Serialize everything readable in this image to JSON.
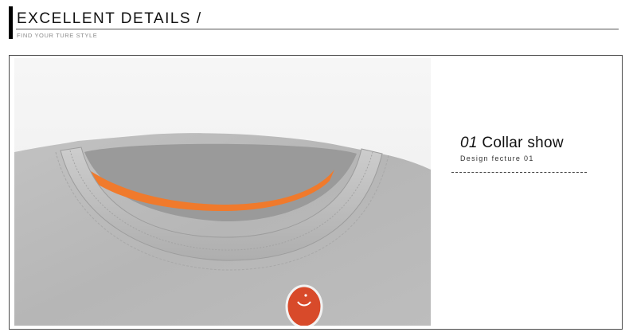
{
  "header": {
    "title": "EXCELLENT  DETAILS /",
    "subtitle": "FIND YOUR TURE STYLE"
  },
  "feature": {
    "number": "01",
    "title": " Collar show",
    "subtitle": "Design fecture 01"
  },
  "photo": {
    "subject": "grey t-shirt collar with orange inner neck tape and red embroidered patch",
    "colors": {
      "shirt": "#b9b9b9",
      "tape": "#f07a2c",
      "patch": "#d84a2a",
      "background": "#f2f2f2"
    }
  }
}
